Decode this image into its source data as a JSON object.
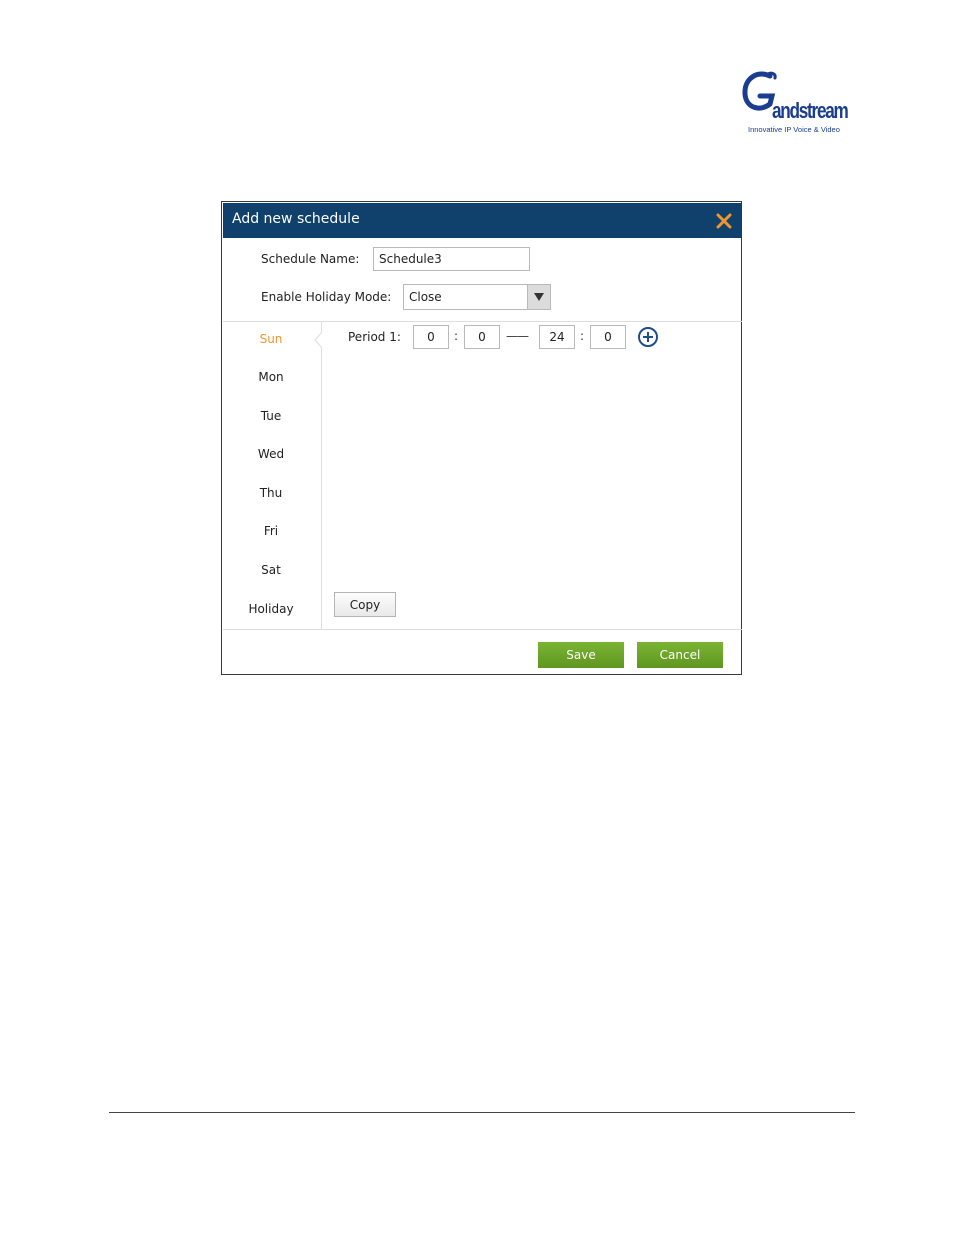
{
  "logo": {
    "brand": "Grandstream",
    "wordmark_text": "andstream",
    "tagline": "Innovative IP Voice & Video"
  },
  "dialog": {
    "title": "Add new schedule",
    "close_icon": "close-icon",
    "schedule_name_label": "Schedule Name:",
    "schedule_name_value": "Schedule3",
    "holiday_mode_label": "Enable Holiday Mode:",
    "holiday_mode_value": "Close",
    "days": [
      "Sun",
      "Mon",
      "Tue",
      "Wed",
      "Thu",
      "Fri",
      "Sat",
      "Holiday"
    ],
    "active_day": "Sun",
    "period": {
      "label": "Period 1:",
      "start_hour": "0",
      "start_minute": "0",
      "separator": ":",
      "range_dash": "——",
      "end_hour": "24",
      "end_minute": "0",
      "add_icon": "plus-circle-icon"
    },
    "copy_label": "Copy",
    "save_label": "Save",
    "cancel_label": "Cancel"
  },
  "colors": {
    "titlebar": "#0f416c",
    "close_icon": "#f0962f",
    "active_day": "#f0962f",
    "button_green": "#6aa528",
    "add_icon": "#1f4e8c"
  }
}
